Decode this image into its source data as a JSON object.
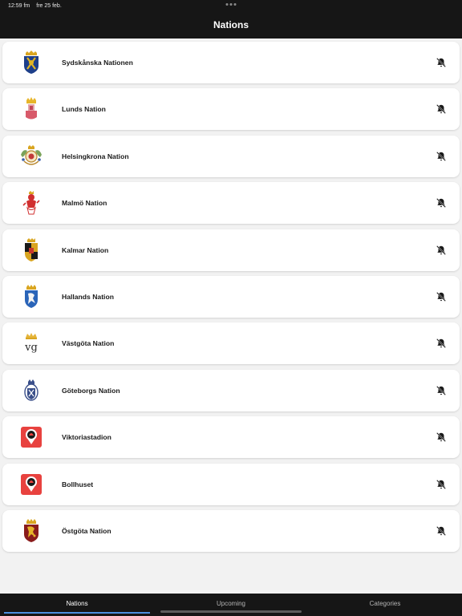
{
  "status_bar": {
    "time": "12:59 fm",
    "date": "fre 25 feb."
  },
  "header": {
    "title": "Nations"
  },
  "nations": [
    {
      "name": "Sydskånska Nationen",
      "logo": "sydskanska-crest"
    },
    {
      "name": "Lunds Nation",
      "logo": "lunds-crest"
    },
    {
      "name": "Helsingkrona Nation",
      "logo": "helsingkrona-crest"
    },
    {
      "name": "Malmö Nation",
      "logo": "malmo-crest"
    },
    {
      "name": "Kalmar Nation",
      "logo": "kalmar-crest"
    },
    {
      "name": "Hallands Nation",
      "logo": "hallands-crest"
    },
    {
      "name": "Västgöta Nation",
      "logo": "vastgota-crest"
    },
    {
      "name": "Göteborgs Nation",
      "logo": "goteborgs-crest"
    },
    {
      "name": "Viktoriastadion",
      "logo": "location-pin-icon"
    },
    {
      "name": "Bollhuset",
      "logo": "location-pin-icon"
    },
    {
      "name": "Östgöta Nation",
      "logo": "ostgota-crest"
    }
  ],
  "bell_icon": "bell-off-icon",
  "tabs": [
    {
      "label": "Nations",
      "active": true
    },
    {
      "label": "Upcoming",
      "active": false
    },
    {
      "label": "Categories",
      "active": false
    }
  ],
  "colors": {
    "accent": "#4a8fe0",
    "bar_bg": "#161616",
    "pin_red": "#e8423f"
  }
}
